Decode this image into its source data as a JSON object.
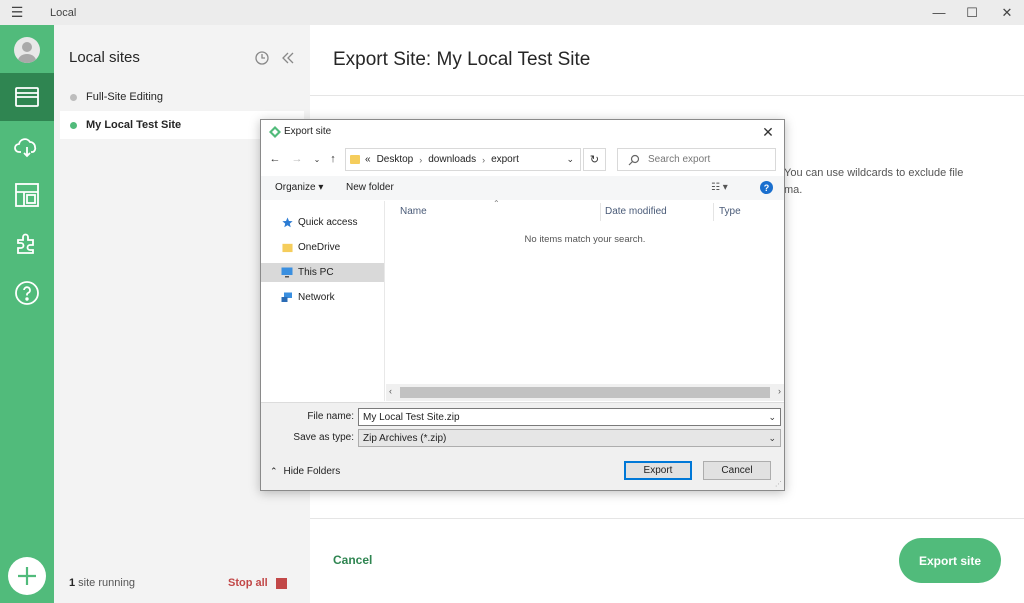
{
  "window": {
    "title": "Local",
    "menu_icon": "hamburger-icon"
  },
  "rail": {
    "items": [
      {
        "name": "avatar"
      },
      {
        "name": "local-sites-icon",
        "active": true
      },
      {
        "name": "cloud-hosting-icon"
      },
      {
        "name": "blueprints-icon"
      },
      {
        "name": "add-ons-icon"
      },
      {
        "name": "help-icon"
      }
    ],
    "add_icon": "plus-icon"
  },
  "sites_panel": {
    "heading": "Local sites",
    "sites": [
      {
        "label": "Full-Site Editing",
        "status": "stopped"
      },
      {
        "label": "My Local Test Site",
        "status": "running"
      }
    ],
    "running_count": "1",
    "running_suffix": " site running",
    "stop_all": "Stop all"
  },
  "main": {
    "title": "Export Site: My Local Test Site",
    "partial_text": "You can use wildcards to exclude file",
    "partial_text2": "ma.",
    "cancel": "Cancel",
    "export_site": "Export site"
  },
  "dialog": {
    "title": "Export site",
    "breadcrumb": [
      "«",
      "Desktop",
      "downloads",
      "export"
    ],
    "search_placeholder": "Search export",
    "organize": "Organize ▾",
    "new_folder": "New folder",
    "nav_items": [
      {
        "label": "Quick access",
        "icon": "star-icon"
      },
      {
        "label": "OneDrive",
        "icon": "folder-icon"
      },
      {
        "label": "This PC",
        "icon": "monitor-icon",
        "selected": true
      },
      {
        "label": "Network",
        "icon": "network-icon"
      }
    ],
    "columns": [
      "Name",
      "Date modified",
      "Type"
    ],
    "empty_message": "No items match your search.",
    "file_name_label": "File name:",
    "file_name_value": "My Local Test Site.zip",
    "save_type_label": "Save as type:",
    "save_type_value": "Zip Archives (*.zip)",
    "hide_folders": "Hide Folders",
    "export_button": "Export",
    "cancel_button": "Cancel"
  },
  "colors": {
    "brand_green": "#51bb7b",
    "brand_green_dark": "#2f8551",
    "stop_red": "#c24848",
    "dialog_accent": "#0078d7"
  }
}
